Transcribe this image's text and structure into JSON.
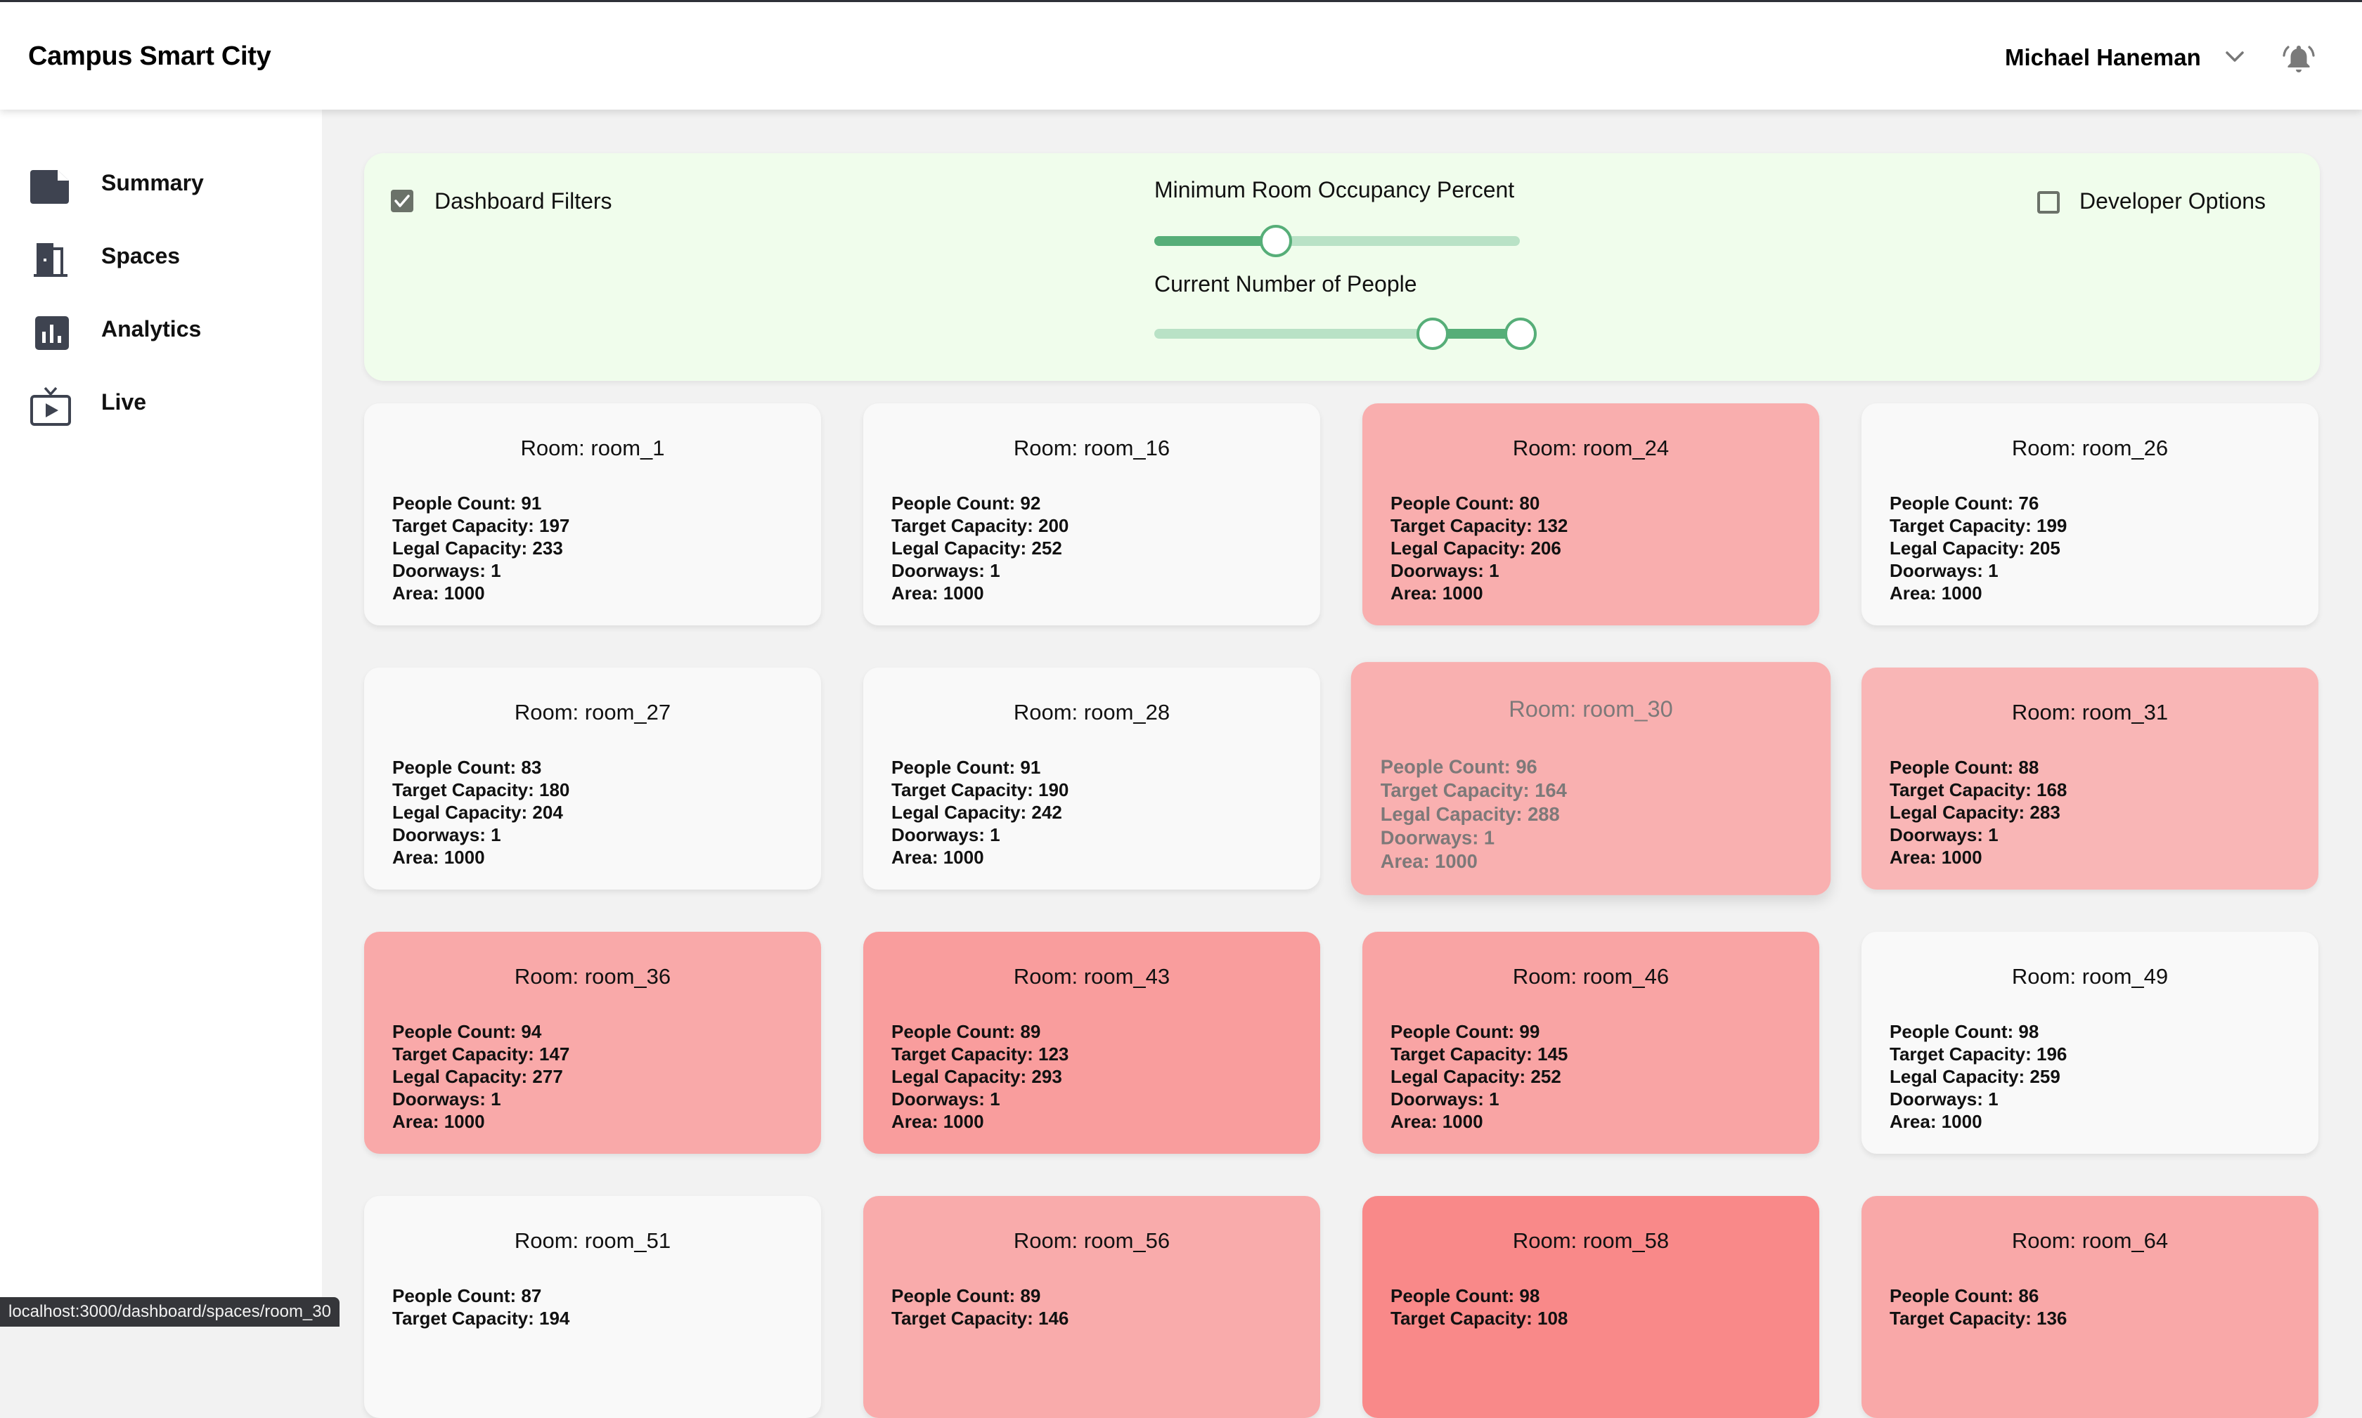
{
  "header": {
    "app_title": "Campus Smart City",
    "user_name": "Michael Haneman",
    "user_menu_icon": "chevron-down-icon",
    "notification_icon": "bell-ringing-icon"
  },
  "sidebar": {
    "items": [
      {
        "label": "Summary",
        "icon": "document-icon"
      },
      {
        "label": "Spaces",
        "icon": "door-icon"
      },
      {
        "label": "Analytics",
        "icon": "bar-chart-icon"
      },
      {
        "label": "Live",
        "icon": "live-tv-icon"
      }
    ]
  },
  "filters": {
    "dashboard_filters": {
      "label": "Dashboard Filters",
      "checked": true
    },
    "developer_options": {
      "label": "Developer Options",
      "checked": false
    },
    "occupancy_slider": {
      "label": "Minimum Room Occupancy Percent",
      "value_fraction": 0.33
    },
    "people_slider": {
      "label": "Current Number of People",
      "low_fraction": 0.76,
      "high_fraction": 1.0
    },
    "accent_color": "#56ae78",
    "panel_color": "#f0fdec"
  },
  "cards": [
    {
      "title": "Room: room_1",
      "people": "People Count: 91",
      "target": "Target Capacity: 197",
      "legal": "Legal Capacity: 233",
      "doorways": "Doorways: 1",
      "area": "Area: 1000",
      "color": "#f9f9f9"
    },
    {
      "title": "Room: room_16",
      "people": "People Count: 92",
      "target": "Target Capacity: 200",
      "legal": "Legal Capacity: 252",
      "doorways": "Doorways: 1",
      "area": "Area: 1000",
      "color": "#f9f9f9"
    },
    {
      "title": "Room: room_24",
      "people": "People Count: 80",
      "target": "Target Capacity: 132",
      "legal": "Legal Capacity: 206",
      "doorways": "Doorways: 1",
      "area": "Area: 1000",
      "color": "#f9aeae"
    },
    {
      "title": "Room: room_26",
      "people": "People Count: 76",
      "target": "Target Capacity: 199",
      "legal": "Legal Capacity: 205",
      "doorways": "Doorways: 1",
      "area": "Area: 1000",
      "color": "#f9f9f9"
    },
    {
      "title": "Room: room_27",
      "people": "People Count: 83",
      "target": "Target Capacity: 180",
      "legal": "Legal Capacity: 204",
      "doorways": "Doorways: 1",
      "area": "Area: 1000",
      "color": "#f9f9f9"
    },
    {
      "title": "Room: room_28",
      "people": "People Count: 91",
      "target": "Target Capacity: 190",
      "legal": "Legal Capacity: 242",
      "doorways": "Doorways: 1",
      "area": "Area: 1000",
      "color": "#f9f9f9"
    },
    {
      "title": "Room: room_30",
      "people": "People Count: 96",
      "target": "Target Capacity: 164",
      "legal": "Legal Capacity: 288",
      "doorways": "Doorways: 1",
      "area": "Area: 1000",
      "color": "#f9b0b0",
      "hovered": true
    },
    {
      "title": "Room: room_31",
      "people": "People Count: 88",
      "target": "Target Capacity: 168",
      "legal": "Legal Capacity: 283",
      "doorways": "Doorways: 1",
      "area": "Area: 1000",
      "color": "#f9b6b6"
    },
    {
      "title": "Room: room_36",
      "people": "People Count: 94",
      "target": "Target Capacity: 147",
      "legal": "Legal Capacity: 277",
      "doorways": "Doorways: 1",
      "area": "Area: 1000",
      "color": "#f9a9a9"
    },
    {
      "title": "Room: room_43",
      "people": "People Count: 89",
      "target": "Target Capacity: 123",
      "legal": "Legal Capacity: 293",
      "doorways": "Doorways: 1",
      "area": "Area: 1000",
      "color": "#f99d9d"
    },
    {
      "title": "Room: room_46",
      "people": "People Count: 99",
      "target": "Target Capacity: 145",
      "legal": "Legal Capacity: 252",
      "doorways": "Doorways: 1",
      "area": "Area: 1000",
      "color": "#f9a4a4"
    },
    {
      "title": "Room: room_49",
      "people": "People Count: 98",
      "target": "Target Capacity: 196",
      "legal": "Legal Capacity: 259",
      "doorways": "Doorways: 1",
      "area": "Area: 1000",
      "color": "#f9f9f9"
    },
    {
      "title": "Room: room_51",
      "people": "People Count: 87",
      "target": "Target Capacity: 194",
      "legal": "",
      "doorways": "",
      "area": "",
      "color": "#f9f9f9"
    },
    {
      "title": "Room: room_56",
      "people": "People Count: 89",
      "target": "Target Capacity: 146",
      "legal": "",
      "doorways": "",
      "area": "",
      "color": "#f9abab"
    },
    {
      "title": "Room: room_58",
      "people": "People Count: 98",
      "target": "Target Capacity: 108",
      "legal": "",
      "doorways": "",
      "area": "",
      "color": "#f98989"
    },
    {
      "title": "Room: room_64",
      "people": "People Count: 86",
      "target": "Target Capacity: 136",
      "legal": "",
      "doorways": "",
      "area": "",
      "color": "#f9a8a8"
    }
  ],
  "status_bar": {
    "url": "localhost:3000/dashboard/spaces/room_30"
  }
}
